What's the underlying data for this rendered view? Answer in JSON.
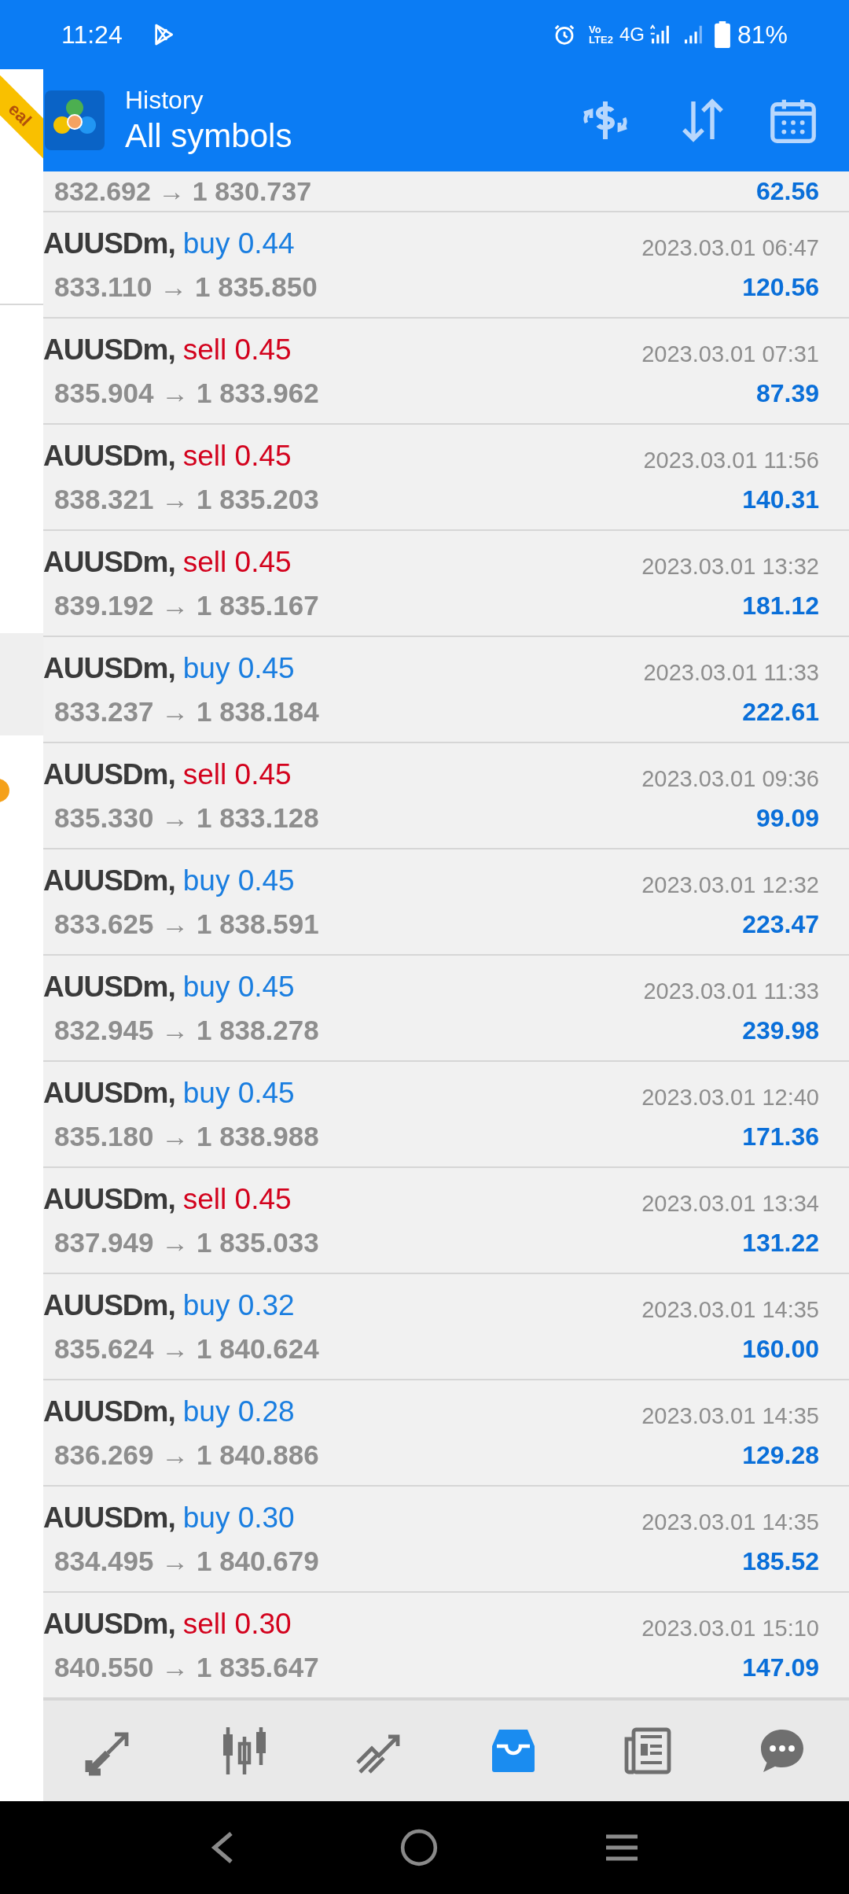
{
  "status_bar": {
    "time": "11:24",
    "volte_top": "Vo",
    "volte_bottom": "LTE2",
    "network": "4G",
    "battery": "81%"
  },
  "account_ribbon": "eal",
  "header": {
    "title": "History",
    "subtitle": "All symbols"
  },
  "partial_row": {
    "prices": "832.692 → 1 830.737",
    "profit": "62.56"
  },
  "trades": [
    {
      "symbol": "AUUSDm,",
      "kind": "buy",
      "order": "buy 0.44",
      "time": "2023.03.01 06:47",
      "prices": "833.110 → 1 835.850",
      "profit": "120.56"
    },
    {
      "symbol": "AUUSDm,",
      "kind": "sell",
      "order": "sell 0.45",
      "time": "2023.03.01 07:31",
      "prices": "835.904 → 1 833.962",
      "profit": "87.39"
    },
    {
      "symbol": "AUUSDm,",
      "kind": "sell",
      "order": "sell 0.45",
      "time": "2023.03.01 11:56",
      "prices": "838.321 → 1 835.203",
      "profit": "140.31"
    },
    {
      "symbol": "AUUSDm,",
      "kind": "sell",
      "order": "sell 0.45",
      "time": "2023.03.01 13:32",
      "prices": "839.192 → 1 835.167",
      "profit": "181.12"
    },
    {
      "symbol": "AUUSDm,",
      "kind": "buy",
      "order": "buy 0.45",
      "time": "2023.03.01 11:33",
      "prices": "833.237 → 1 838.184",
      "profit": "222.61"
    },
    {
      "symbol": "AUUSDm,",
      "kind": "sell",
      "order": "sell 0.45",
      "time": "2023.03.01 09:36",
      "prices": "835.330 → 1 833.128",
      "profit": "99.09"
    },
    {
      "symbol": "AUUSDm,",
      "kind": "buy",
      "order": "buy 0.45",
      "time": "2023.03.01 12:32",
      "prices": "833.625 → 1 838.591",
      "profit": "223.47"
    },
    {
      "symbol": "AUUSDm,",
      "kind": "buy",
      "order": "buy 0.45",
      "time": "2023.03.01 11:33",
      "prices": "832.945 → 1 838.278",
      "profit": "239.98"
    },
    {
      "symbol": "AUUSDm,",
      "kind": "buy",
      "order": "buy 0.45",
      "time": "2023.03.01 12:40",
      "prices": "835.180 → 1 838.988",
      "profit": "171.36"
    },
    {
      "symbol": "AUUSDm,",
      "kind": "sell",
      "order": "sell 0.45",
      "time": "2023.03.01 13:34",
      "prices": "837.949 → 1 835.033",
      "profit": "131.22"
    },
    {
      "symbol": "AUUSDm,",
      "kind": "buy",
      "order": "buy 0.32",
      "time": "2023.03.01 14:35",
      "prices": "835.624 → 1 840.624",
      "profit": "160.00"
    },
    {
      "symbol": "AUUSDm,",
      "kind": "buy",
      "order": "buy 0.28",
      "time": "2023.03.01 14:35",
      "prices": "836.269 → 1 840.886",
      "profit": "129.28"
    },
    {
      "symbol": "AUUSDm,",
      "kind": "buy",
      "order": "buy 0.30",
      "time": "2023.03.01 14:35",
      "prices": "834.495 → 1 840.679",
      "profit": "185.52"
    },
    {
      "symbol": "AUUSDm,",
      "kind": "sell",
      "order": "sell 0.30",
      "time": "2023.03.01 15:10",
      "prices": "840.550 → 1 835.647",
      "profit": "147.09"
    }
  ],
  "bottom_tabs": [
    {
      "kind": "trade",
      "selected": false
    },
    {
      "kind": "chart",
      "selected": false
    },
    {
      "kind": "quotes",
      "selected": false
    },
    {
      "kind": "history",
      "selected": true
    },
    {
      "kind": "news",
      "selected": false
    },
    {
      "kind": "chat",
      "selected": false
    }
  ]
}
